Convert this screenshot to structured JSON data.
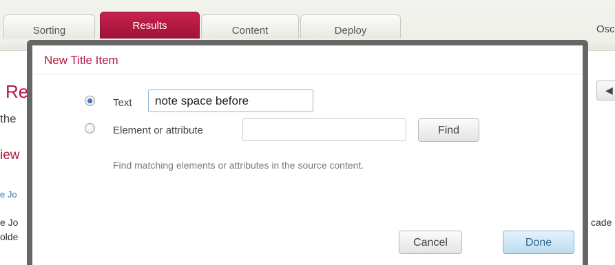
{
  "tabs": [
    {
      "label": "Sorting"
    },
    {
      "label": "Results",
      "active": true
    },
    {
      "label": "Content"
    },
    {
      "label": "Deploy"
    }
  ],
  "user_name": "Osc",
  "background": {
    "heading": "Re",
    "text1": "the",
    "link1": "iew",
    "link2": "e Jo",
    "text2": "e Jo",
    "text3": "olde",
    "text4": "cade"
  },
  "dialog": {
    "title": "New Title Item",
    "option_text": {
      "label": "Text",
      "value": "note space before",
      "checked": true
    },
    "option_element": {
      "label": "Element or attribute",
      "value": "",
      "checked": false
    },
    "find_label": "Find",
    "hint": "Find matching elements or attributes in the source content.",
    "cancel_label": "Cancel",
    "done_label": "Done"
  },
  "colors": {
    "accent": "#b4173f",
    "tab_active": "#b01b43",
    "overlay_frame": "#666666",
    "primary_button": "#bddcef"
  }
}
